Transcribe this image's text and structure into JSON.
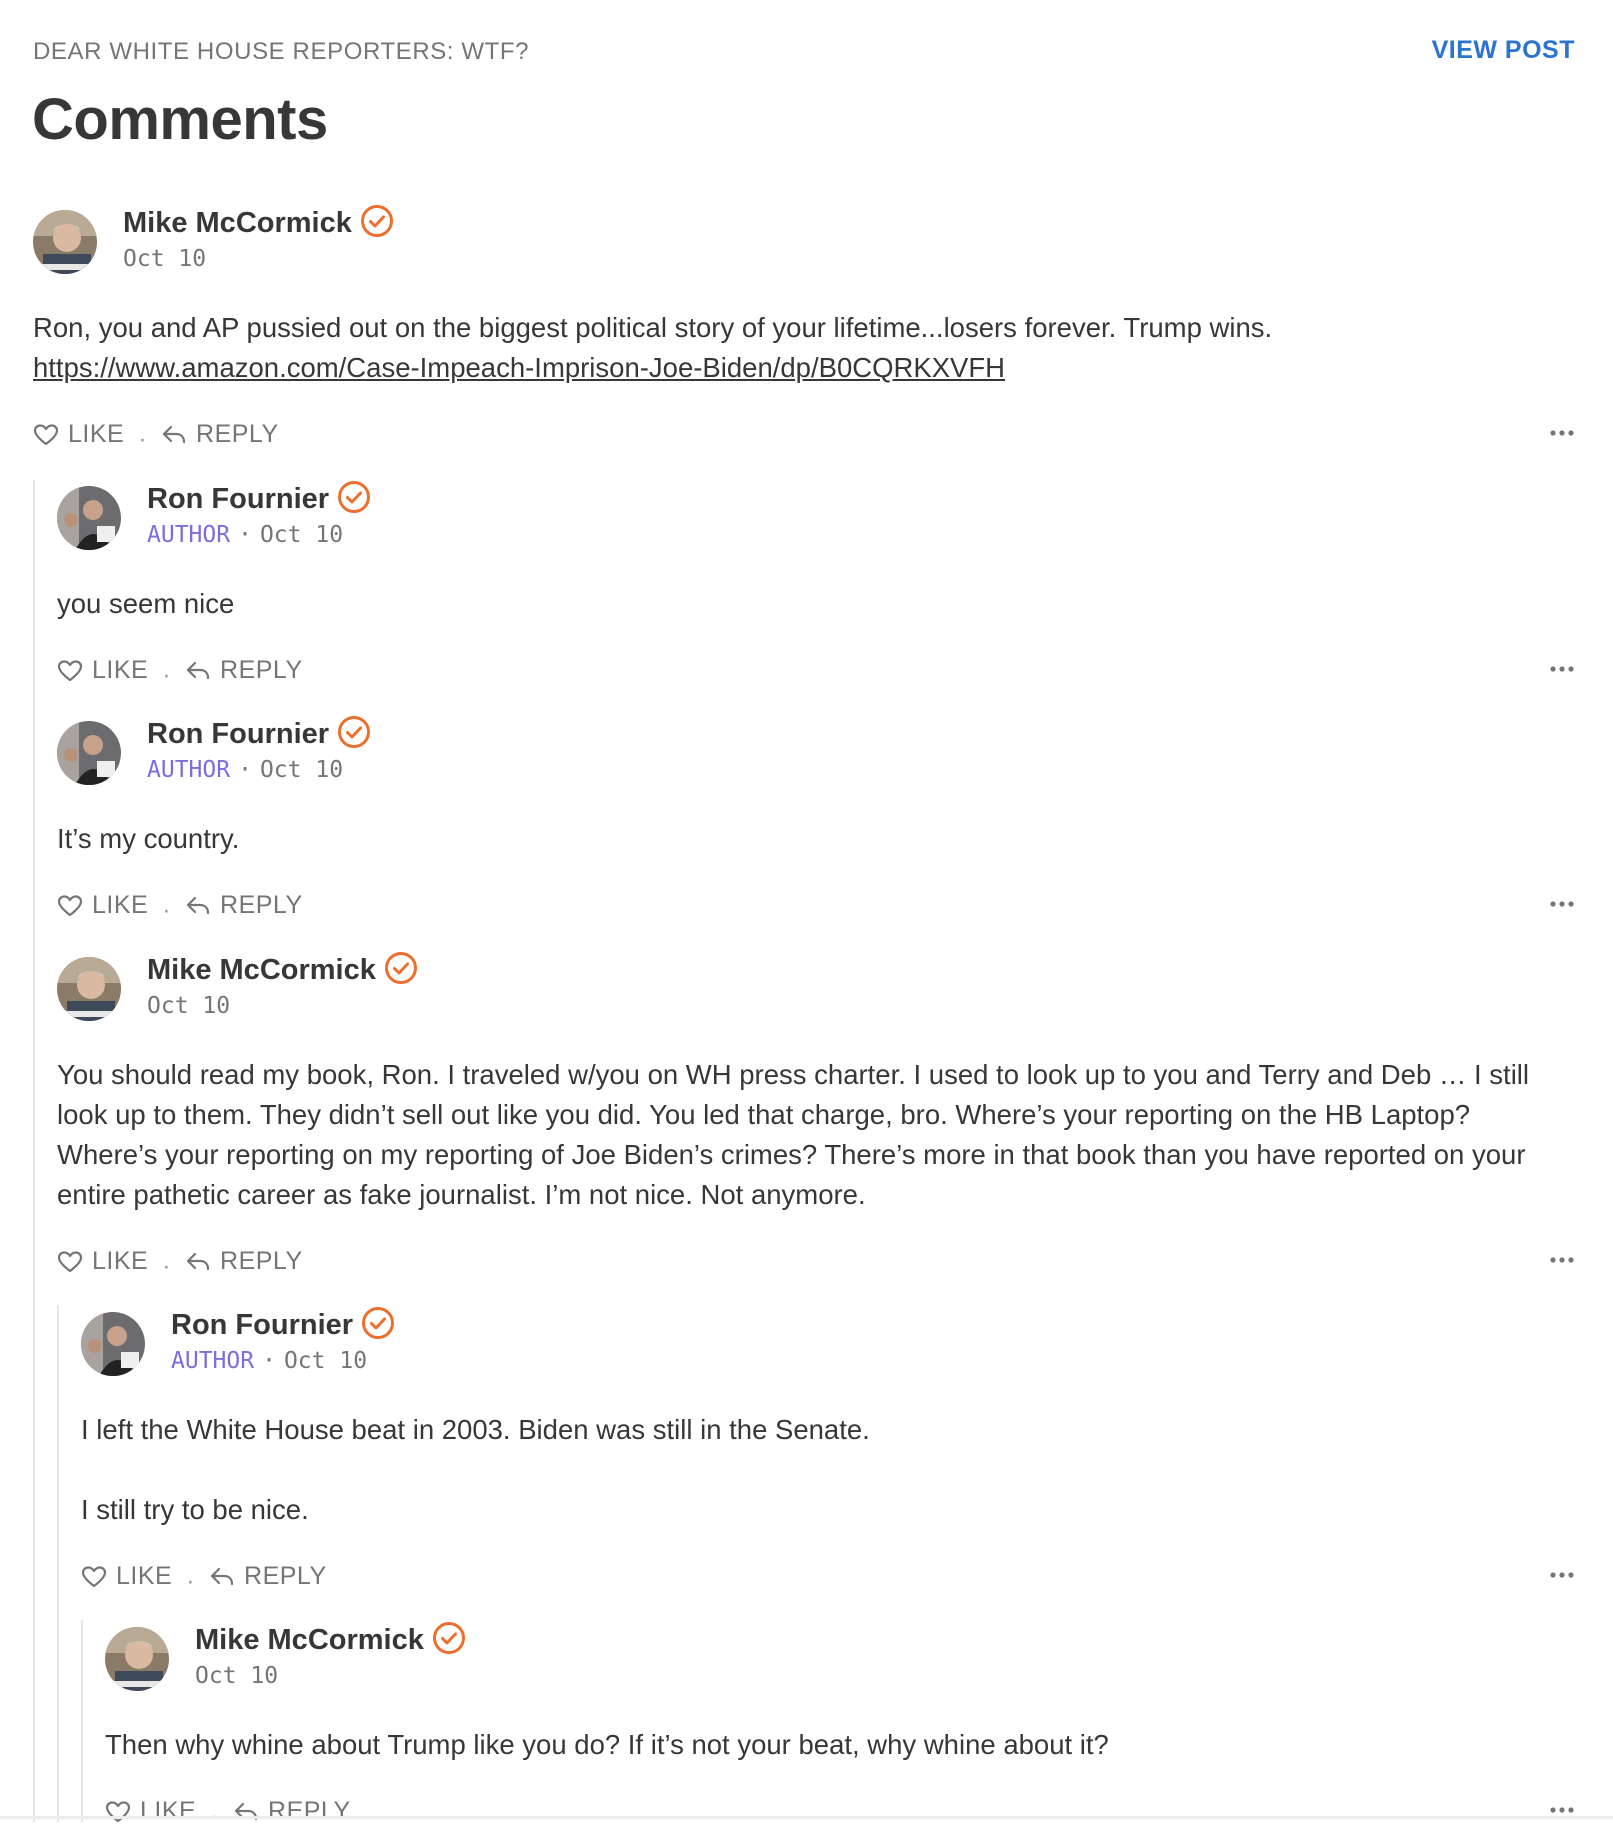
{
  "header": {
    "kicker": "DEAR WHITE HOUSE REPORTERS: WTF?",
    "view_post": "VIEW POST",
    "title": "Comments"
  },
  "actions": {
    "like": "LIKE",
    "reply": "REPLY",
    "separator": "·"
  },
  "comments": [
    {
      "author": "Mike McCormick",
      "author_tag": "",
      "date": "Oct 10",
      "avatar": "mike-mccormick-avatar",
      "text": "Ron, you and AP pussied out on the biggest political story of your lifetime...losers forever. Trump wins.",
      "link": "https://www.amazon.com/Case-Impeach-Imprison-Joe-Biden/dp/B0CQRKXVFH"
    },
    {
      "author": "Ron Fournier",
      "author_tag": "AUTHOR",
      "date": "Oct 10",
      "avatar": "ron-fournier-avatar",
      "text": "you seem nice"
    },
    {
      "author": "Ron Fournier",
      "author_tag": "AUTHOR",
      "date": "Oct 10",
      "avatar": "ron-fournier-avatar",
      "text": "It’s my country."
    },
    {
      "author": "Mike McCormick",
      "author_tag": "",
      "date": "Oct 10",
      "avatar": "mike-mccormick-avatar",
      "text": "You should read my book, Ron. I traveled w/you on WH press charter. I used to look up to you and Terry and Deb … I still look up to them. They didn’t sell out like you did. You led that charge, bro. Where’s your reporting on the HB Laptop? Where’s your reporting on my reporting of Joe Biden’s crimes? There’s more in that book than you have reported on your entire pathetic career as fake journalist. I’m not nice. Not anymore."
    },
    {
      "author": "Ron Fournier",
      "author_tag": "AUTHOR",
      "date": "Oct 10",
      "avatar": "ron-fournier-avatar",
      "text": "I left the White House beat in 2003. Biden was still in the Senate.",
      "text2": "I still try to be nice."
    },
    {
      "author": "Mike McCormick",
      "author_tag": "",
      "date": "Oct 10",
      "avatar": "mike-mccormick-avatar",
      "text": "Then why whine about Trump like you do? If it’s not your beat, why whine about it?"
    }
  ],
  "colors": {
    "accent_link": "#2a73cf",
    "badge_orange": "#ec6f2d",
    "author_purple": "#7b6ddb",
    "muted_text": "#757575",
    "body_text": "#363737"
  },
  "icons": [
    "verified-badge-icon",
    "heart-icon",
    "reply-arrow-icon",
    "more-ellipsis-icon"
  ]
}
